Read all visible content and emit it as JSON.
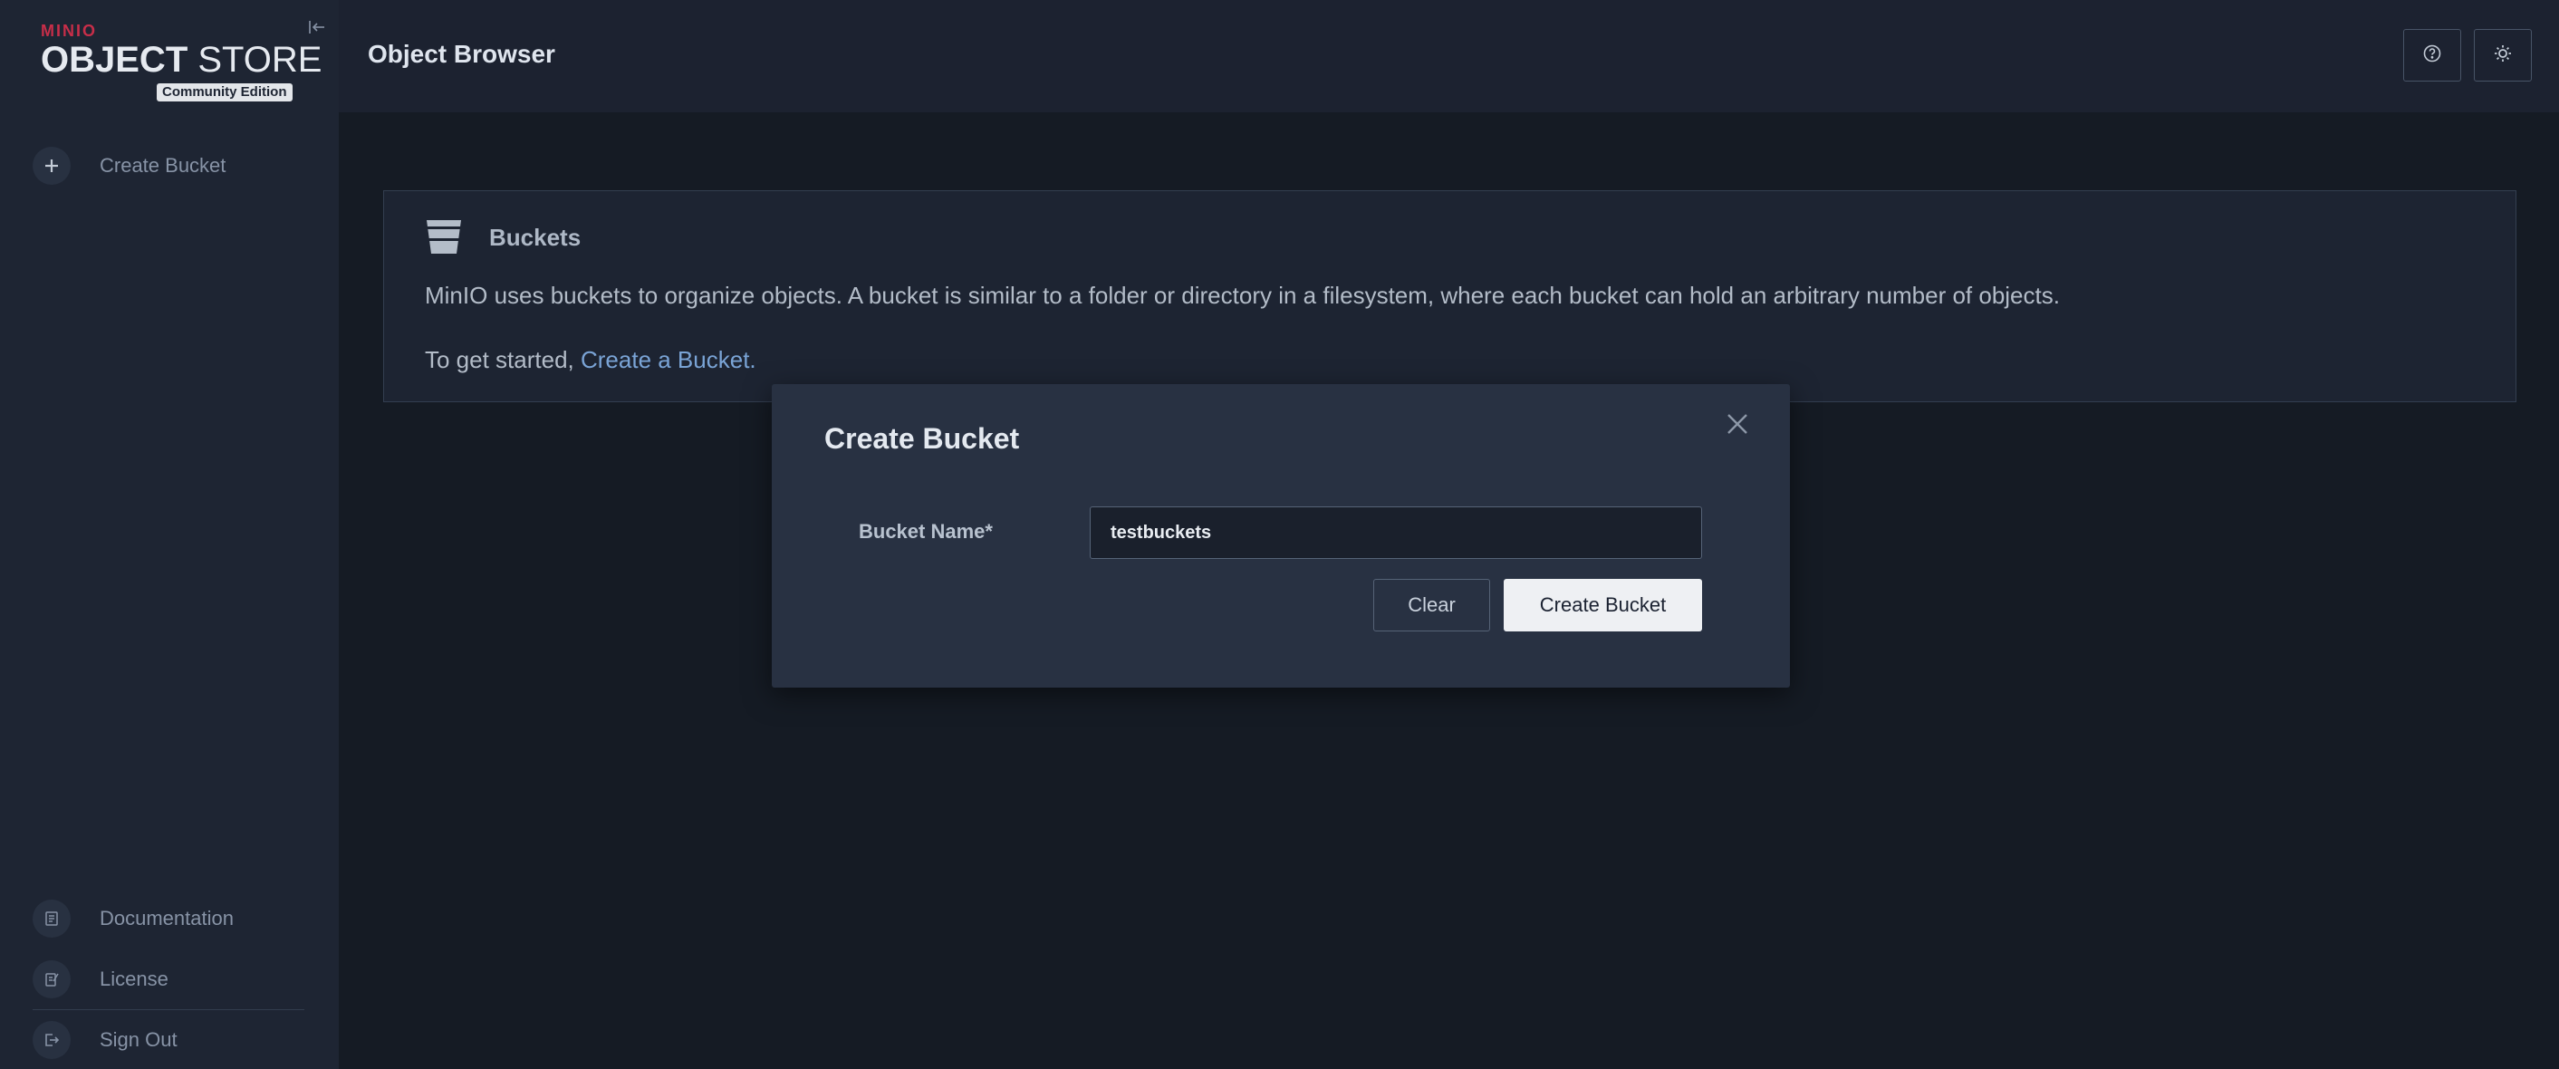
{
  "sidebar": {
    "brand": "MINIO",
    "title_bold": "OBJECT",
    "title_light": " STORE",
    "edition": "Community Edition",
    "items": [
      {
        "label": "Create Bucket",
        "icon": "plus-icon"
      },
      {
        "label": "Documentation",
        "icon": "documentation-icon"
      },
      {
        "label": "License",
        "icon": "license-icon"
      },
      {
        "label": "Sign Out",
        "icon": "sign-out-icon"
      }
    ]
  },
  "header": {
    "title": "Object Browser",
    "buttons": [
      "help-icon",
      "theme-toggle-icon"
    ]
  },
  "buckets_panel": {
    "title": "Buckets",
    "description": "MinIO uses buckets to organize objects. A bucket is similar to a folder or directory in a filesystem, where each bucket can hold an arbitrary number of objects.",
    "start_prefix": "To get started, ",
    "start_link": "Create a Bucket."
  },
  "modal": {
    "title": "Create Bucket",
    "field_label": "Bucket Name*",
    "field_value": "testbuckets",
    "clear_label": "Clear",
    "create_label": "Create Bucket"
  },
  "colors": {
    "background": "#151b24",
    "sidebar": "#1e2533",
    "brand_red": "#c72e49",
    "link": "#7aa4d6",
    "modal": "#283142"
  }
}
